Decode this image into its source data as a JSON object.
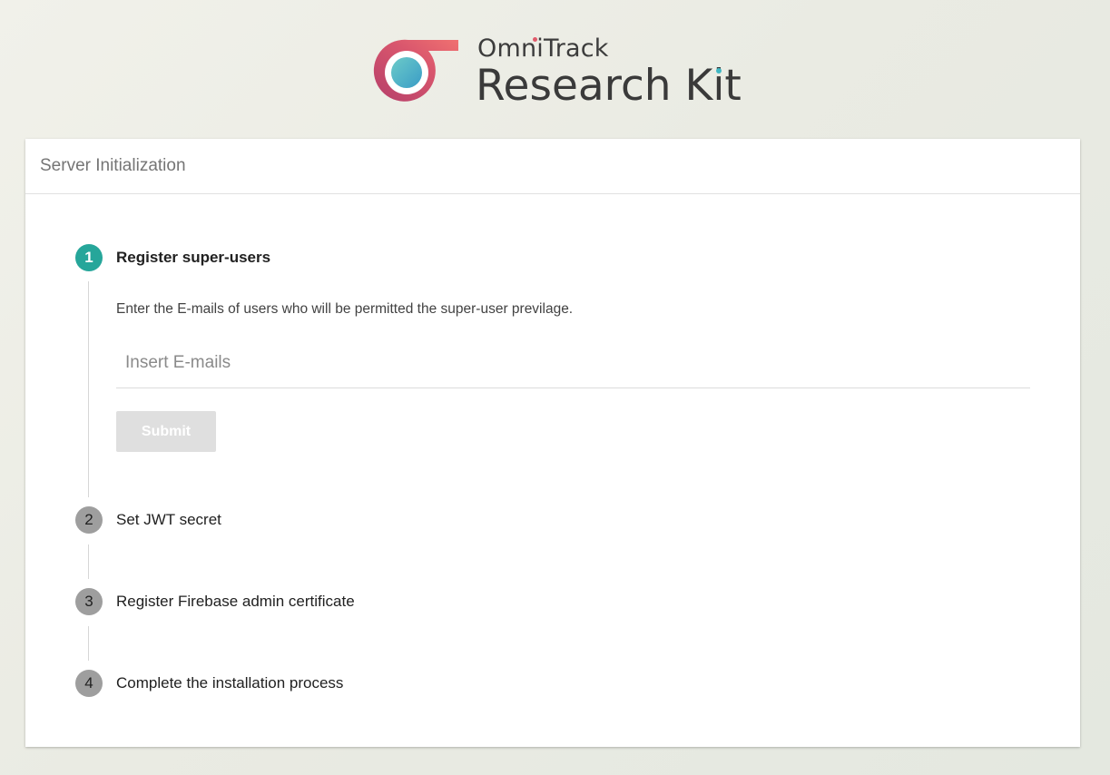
{
  "logo": {
    "top_word": "OmniTrack",
    "main_word": "Research Kit",
    "colors": {
      "ring_start": "#c0416e",
      "ring_end": "#ef6f6c",
      "core_start": "#5cc3c9",
      "core_end": "#3a9ec4"
    }
  },
  "card": {
    "title": "Server Initialization"
  },
  "steps": [
    {
      "number": "1",
      "label": "Register super-users",
      "state": "active",
      "description": "Enter the E-mails of users who will be permitted the super-user previlage.",
      "input": {
        "placeholder": "Insert E-mails",
        "value": ""
      },
      "submit_label": "Submit"
    },
    {
      "number": "2",
      "label": "Set JWT secret",
      "state": "inactive"
    },
    {
      "number": "3",
      "label": "Register Firebase admin certificate",
      "state": "inactive"
    },
    {
      "number": "4",
      "label": "Complete the installation process",
      "state": "inactive"
    }
  ],
  "colors": {
    "active_step": "#26a69a",
    "inactive_step": "#9e9e9e",
    "disabled_button": "#dfdfdf"
  }
}
